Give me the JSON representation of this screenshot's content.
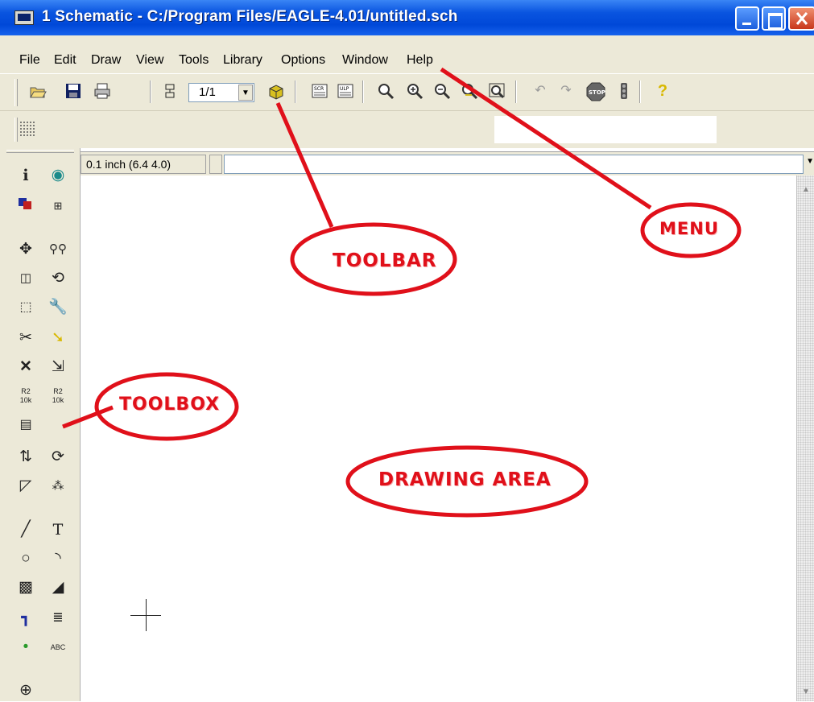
{
  "window": {
    "title": "1 Schematic - C:/Program Files/EAGLE-4.01/untitled.sch"
  },
  "menu": [
    {
      "label": "File"
    },
    {
      "label": "Edit"
    },
    {
      "label": "Draw"
    },
    {
      "label": "View"
    },
    {
      "label": "Tools"
    },
    {
      "label": "Library"
    },
    {
      "label": "Options"
    },
    {
      "label": "Window"
    },
    {
      "label": "Help"
    }
  ],
  "toolbar": {
    "sheet_select_value": "1/1",
    "icons": [
      "open-icon",
      "save-icon",
      "print-icon",
      "sheet-icon",
      "use-icon",
      "script-icon",
      "ulp-icon",
      "zoom-fit-icon",
      "zoom-in-icon",
      "zoom-out-icon",
      "redraw-icon",
      "zoom-select-icon",
      "undo-icon",
      "redo-icon",
      "stop-icon",
      "go-icon",
      "help-icon"
    ]
  },
  "command_row": {
    "coordinates": "0.1 inch (6.4 4.0)",
    "command_value": ""
  },
  "toolbox": {
    "icons": [
      "info-icon",
      "show-icon",
      "display-icon",
      "grid-icon",
      "move-icon",
      "copy-icon",
      "mirror-icon",
      "rotate-icon",
      "group-icon",
      "change-icon",
      "cut-icon",
      "paste-icon",
      "delete-icon",
      "add-icon",
      "name-icon",
      "value-icon",
      "smash-icon",
      "pinswap-icon",
      "gateswap-icon",
      "split-icon",
      "invoke-icon",
      "wire-icon",
      "text-icon",
      "circle-icon",
      "arc-icon",
      "rect-icon",
      "polygon-icon",
      "bus-icon",
      "net-icon",
      "junction-icon",
      "label-icon",
      "erc-icon"
    ]
  },
  "annotations": {
    "menu": "MENU",
    "toolbar": "TOOLBAR",
    "toolbox": "TOOLBOX",
    "drawing_area": "DRAWING AREA"
  },
  "colors": {
    "title_bar": "#0a55e0",
    "chrome": "#ece9d8",
    "annotation": "#e0101a"
  }
}
